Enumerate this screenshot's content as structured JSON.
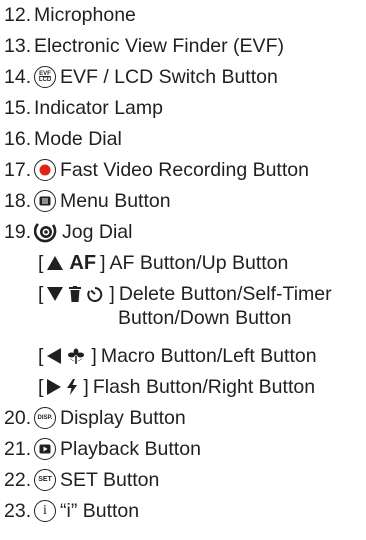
{
  "items": [
    {
      "num": "12.",
      "label": "Microphone"
    },
    {
      "num": "13.",
      "label": "Electronic View Finder (EVF)"
    },
    {
      "num": "14.",
      "icon_text_top": "EVF",
      "icon_text_bottom": "LCD",
      "icon": "evf-lcd-switch-icon",
      "label": "EVF / LCD Switch Button"
    },
    {
      "num": "15.",
      "label": "Indicator Lamp"
    },
    {
      "num": "16.",
      "label": "Mode Dial"
    },
    {
      "num": "17.",
      "icon": "record-icon",
      "icon_color": "#e2231a",
      "label": "Fast Video Recording Button"
    },
    {
      "num": "18.",
      "icon": "menu-icon",
      "label": "Menu Button"
    },
    {
      "num": "19.",
      "icon": "jog-dial-icon",
      "label": "Jog Dial"
    },
    {
      "num": "20.",
      "icon_text": "DISP.",
      "icon": "display-icon",
      "label": "Display Button"
    },
    {
      "num": "21.",
      "icon": "playback-icon",
      "label": "Playback Button"
    },
    {
      "num": "22.",
      "icon_text": "SET",
      "icon": "set-icon",
      "label": "SET Button"
    },
    {
      "num": "23.",
      "icon_text": "i",
      "icon": "info-icon",
      "label": "“i” Button"
    }
  ],
  "jog_subitems": [
    {
      "open": "[",
      "icons": [
        "up-arrow-icon"
      ],
      "af": "AF",
      "close": "]",
      "label": "AF Button/Up Button"
    },
    {
      "open": "[",
      "icons": [
        "down-arrow-icon",
        "delete-icon",
        "self-timer-icon"
      ],
      "close": "]",
      "label": "Delete Button/Self-Timer",
      "label2": "Button/Down Button"
    },
    {
      "open": "[",
      "icons": [
        "left-arrow-icon",
        "macro-icon"
      ],
      "close": "]",
      "label": "Macro Button/Left Button"
    },
    {
      "open": "[",
      "icons": [
        "right-arrow-icon",
        "flash-icon"
      ],
      "close": "]",
      "label": "Flash Button/Right Button"
    }
  ]
}
